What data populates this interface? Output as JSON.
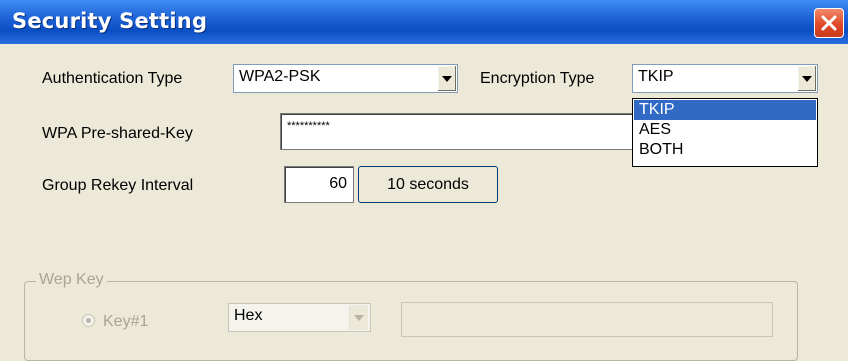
{
  "window": {
    "title": "Security Setting"
  },
  "auth": {
    "label": "Authentication Type",
    "value": "WPA2-PSK"
  },
  "encryption": {
    "label": "Encryption Type",
    "value": "TKIP",
    "options": [
      "TKIP",
      "AES",
      "BOTH"
    ],
    "highlighted": "TKIP"
  },
  "psk": {
    "label": "WPA Pre-shared-Key",
    "value": "**********"
  },
  "rekey": {
    "label": "Group Rekey Interval",
    "value": "60",
    "unit_button": "10 seconds"
  },
  "wep": {
    "group_title": "Wep Key",
    "key1_label": "Key#1",
    "key1_format": "Hex",
    "key1_value": ""
  },
  "colors": {
    "titlebar": "#0a4ec4",
    "selection": "#316ac5",
    "dialog_bg": "#ece9d8",
    "disabled_text": "#a9a593"
  }
}
